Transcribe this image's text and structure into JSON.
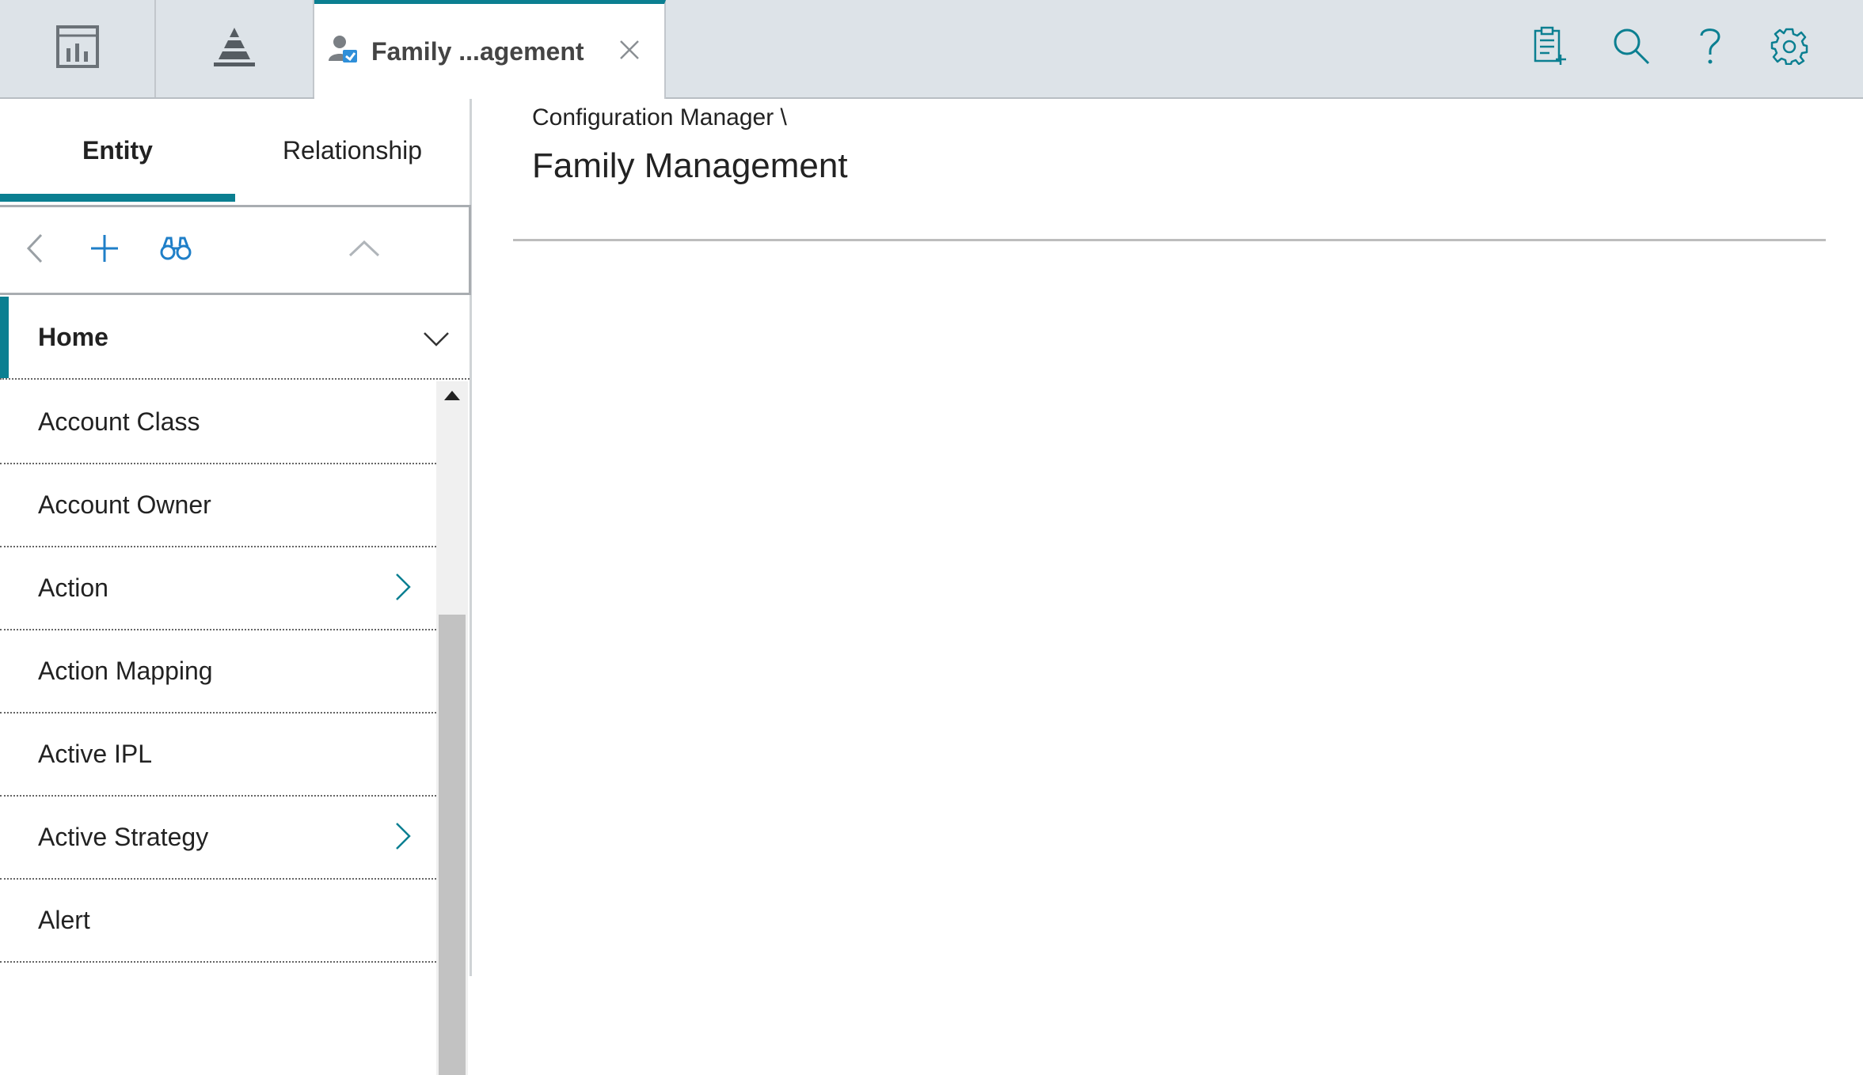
{
  "header": {
    "active_tab_title": "Family ...agement",
    "colors": {
      "accent": "#0b7f91",
      "topbar": "#dde3e8"
    },
    "icons": {
      "tile_1": "dashboard-icon",
      "tile_2": "pyramid-icon",
      "tab": "family-user-icon",
      "close": "close-icon",
      "right": [
        "clipboard-add-icon",
        "search-icon",
        "help-icon",
        "gear-icon"
      ]
    }
  },
  "left_panel": {
    "tabs": [
      {
        "label": "Entity"
      },
      {
        "label": "Relationship"
      }
    ],
    "toolbar_icons": [
      "chevron-left-icon",
      "plus-icon",
      "binoculars-icon",
      "chevron-up-icon"
    ],
    "home": {
      "label": "Home"
    },
    "items": [
      {
        "label": "Account Class",
        "has_children": false
      },
      {
        "label": "Account Owner",
        "has_children": false
      },
      {
        "label": "Action",
        "has_children": true
      },
      {
        "label": "Action Mapping",
        "has_children": false
      },
      {
        "label": "Active IPL",
        "has_children": false
      },
      {
        "label": "Active Strategy",
        "has_children": true
      },
      {
        "label": "Alert",
        "has_children": false
      }
    ]
  },
  "main": {
    "breadcrumb": "Configuration Manager \\",
    "title": "Family Management"
  }
}
